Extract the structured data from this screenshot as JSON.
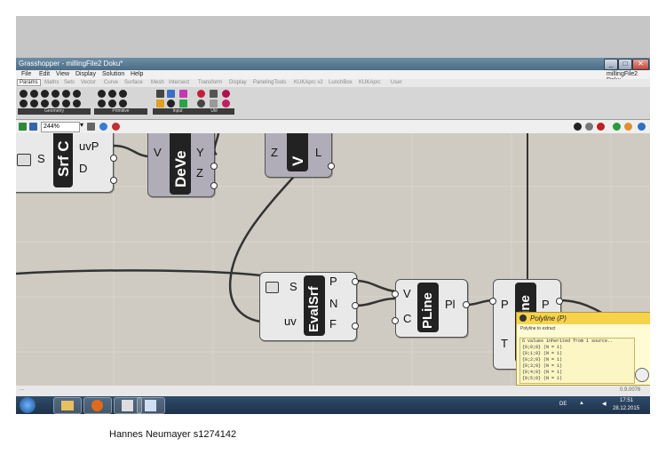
{
  "window": {
    "title": "Grasshopper - millingFile2 Doku*",
    "doc_name": "millingFile2 Doku",
    "buttons": [
      "_",
      "□",
      "✕"
    ]
  },
  "menu": [
    "File",
    "Edit",
    "View",
    "Display",
    "Solution",
    "Help"
  ],
  "tabs": [
    "Params",
    "Maths",
    "Sets",
    "Vector",
    "Curve",
    "Surface",
    "Mesh",
    "Intersect",
    "Transform",
    "Display",
    "PanelingTools",
    "KUKAprc v2",
    "LunchBox",
    "KUKAprc",
    "User"
  ],
  "ribbon_groups": [
    "Geometry",
    "Primitive",
    "Input",
    "Util"
  ],
  "toolbar": {
    "zoom": "244%"
  },
  "components": {
    "srf": {
      "label": "Srf C",
      "ports": [
        "S",
        "uvP",
        "D"
      ]
    },
    "deve": {
      "label": "DeVe",
      "ports": [
        "V",
        "Y",
        "Z"
      ]
    },
    "vl": {
      "label": "V",
      "ports": [
        "Z",
        "L"
      ]
    },
    "evalsrf": {
      "label": "EvalSrf",
      "ports_in": [
        "S",
        "uv"
      ],
      "ports_out": [
        "P",
        "N",
        "F"
      ]
    },
    "pline": {
      "label": "PLine",
      "ports_in": [
        "V",
        "C"
      ],
      "ports_out": [
        "Pl"
      ]
    },
    "line": {
      "label": "line",
      "ports_in": [
        "P",
        "T"
      ],
      "ports_out": [
        "P"
      ]
    }
  },
  "tooltip": {
    "title": "Polyline (P)",
    "subtitle": "Polyline to extract",
    "lines": [
      "6 values inherited from 1 source..",
      "{0;0;0} (N = 1)",
      "{0;1;0} (N = 1)",
      "{0;2;0} (N = 1)",
      "{0;3;0} (N = 1)",
      "{0;4;0} (N = 1)",
      "{0;5;0} (N = 1)"
    ]
  },
  "status": {
    "version": "0.9.0076",
    "dots": "..."
  },
  "taskbar": {
    "lang": "DE",
    "time": "17:51",
    "date": "28.12.2015"
  },
  "caption": "Hannes Neumayer s1274142"
}
